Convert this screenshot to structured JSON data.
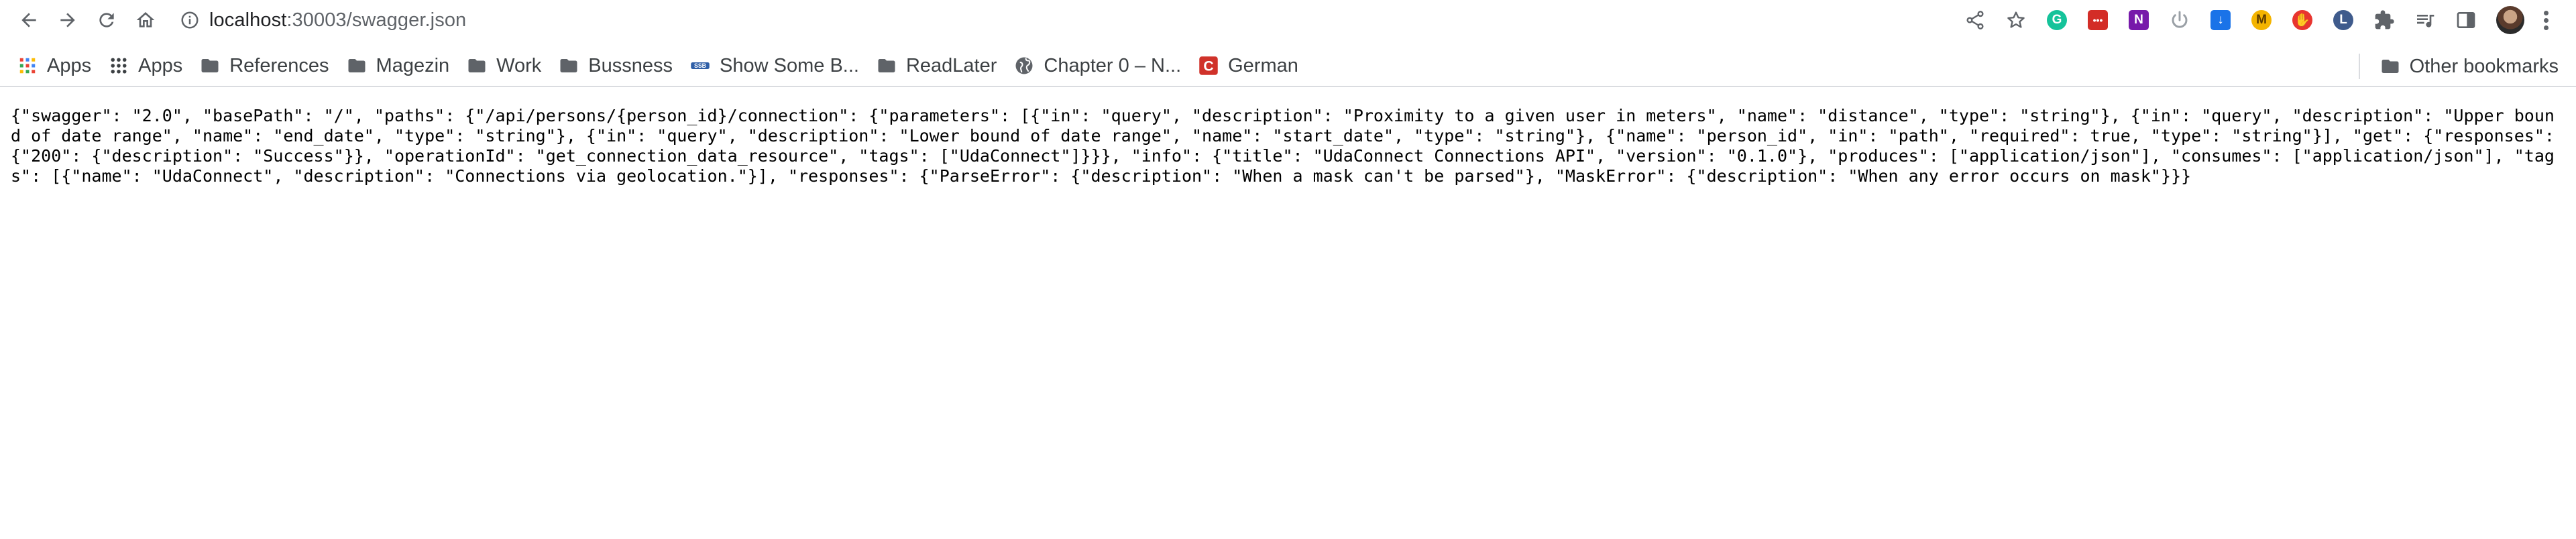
{
  "toolbar": {
    "url_host": "localhost",
    "url_path": ":30003/swagger.json",
    "icons": [
      "back-icon",
      "forward-icon",
      "reload-icon",
      "home-icon",
      "info-icon",
      "share-icon",
      "star-icon"
    ],
    "extensions": [
      {
        "name": "grammarly-extension",
        "letter": "G",
        "color": "#15c39a",
        "shape": "round"
      },
      {
        "name": "lastpass-extension",
        "letter": "•••",
        "color": "#d32d27",
        "shape": "square"
      },
      {
        "name": "onenote-extension",
        "letter": "N",
        "color": "#7719aa",
        "shape": "square"
      },
      {
        "name": "power-extension",
        "letter": "⏻",
        "color": "#9aa0a6",
        "shape": "round"
      },
      {
        "name": "download-extension",
        "letter": "↓",
        "color": "#1a73e8",
        "shape": "square"
      },
      {
        "name": "m-extension",
        "letter": "M",
        "color": "#f4b400",
        "shape": "round"
      },
      {
        "name": "red-extension",
        "letter": "✋",
        "color": "#e8352f",
        "shape": "round"
      },
      {
        "name": "l-extension",
        "letter": "L",
        "color": "#3f5b8c",
        "shape": "round"
      }
    ]
  },
  "bookmarks": [
    {
      "label": "Apps",
      "icon": "google-apps-icon"
    },
    {
      "label": "Apps",
      "icon": "apps-grid-icon"
    },
    {
      "label": "References",
      "icon": "folder-icon"
    },
    {
      "label": "Magezin",
      "icon": "folder-icon"
    },
    {
      "label": "Work",
      "icon": "folder-icon"
    },
    {
      "label": "Bussness",
      "icon": "folder-icon"
    },
    {
      "label": "Show Some B...",
      "icon": "site-icon"
    },
    {
      "label": "ReadLater",
      "icon": "folder-icon"
    },
    {
      "label": "Chapter 0 – N...",
      "icon": "globe-icon"
    },
    {
      "label": "German",
      "icon": "c-site-icon"
    }
  ],
  "other_bookmarks": "Other bookmarks",
  "content": {
    "json_text": "{\"swagger\": \"2.0\", \"basePath\": \"/\", \"paths\": {\"/api/persons/{person_id}/connection\": {\"parameters\": [{\"in\": \"query\", \"description\": \"Proximity to a given user in meters\", \"name\": \"distance\", \"type\": \"string\"}, {\"in\": \"query\", \"description\": \"Upper bound of date range\", \"name\": \"end_date\", \"type\": \"string\"}, {\"in\": \"query\", \"description\": \"Lower bound of date range\", \"name\": \"start_date\", \"type\": \"string\"}, {\"name\": \"person_id\", \"in\": \"path\", \"required\": true, \"type\": \"string\"}], \"get\": {\"responses\": {\"200\": {\"description\": \"Success\"}}, \"operationId\": \"get_connection_data_resource\", \"tags\": [\"UdaConnect\"]}}}, \"info\": {\"title\": \"UdaConnect Connections API\", \"version\": \"0.1.0\"}, \"produces\": [\"application/json\"], \"consumes\": [\"application/json\"], \"tags\": [{\"name\": \"UdaConnect\", \"description\": \"Connections via geolocation.\"}], \"responses\": {\"ParseError\": {\"description\": \"When a mask can't be parsed\"}, \"MaskError\": {\"description\": \"When any error occurs on mask\"}}}"
  }
}
